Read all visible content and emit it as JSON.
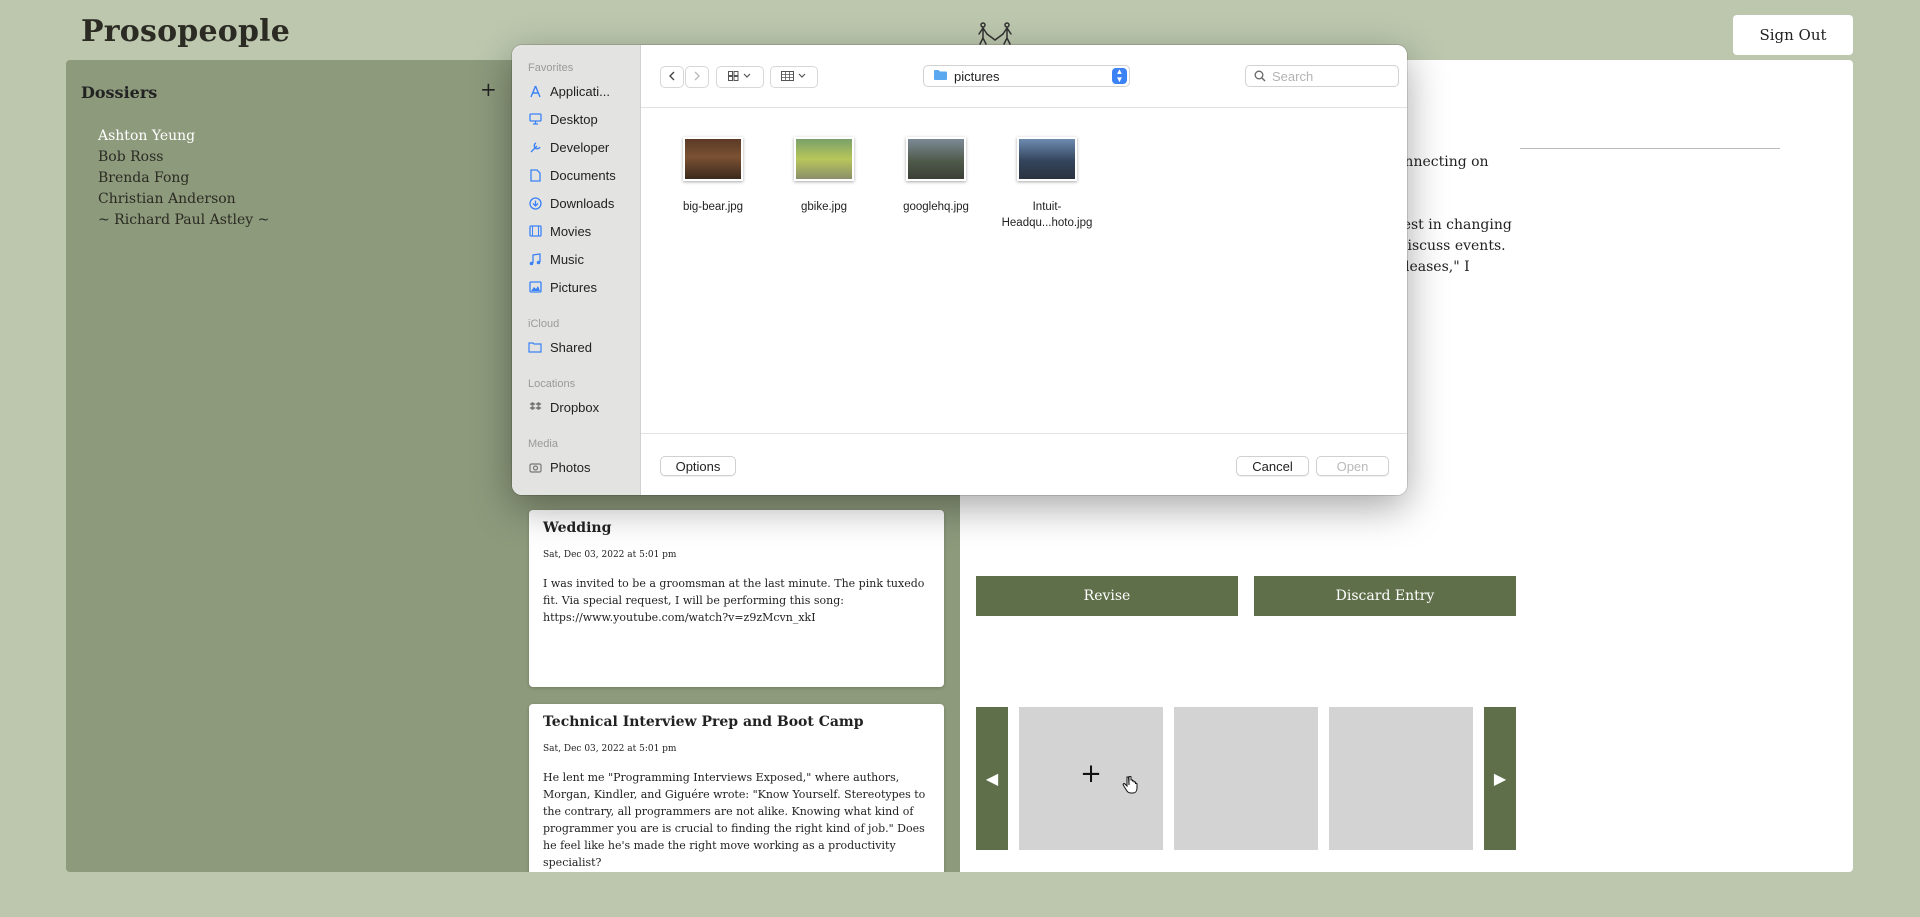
{
  "header": {
    "app_title": "Prosopeople",
    "sign_out_label": "Sign Out"
  },
  "sidebar": {
    "title": "Dossiers",
    "add_label": "+",
    "dossiers": [
      "Ashton Yeung",
      "Bob Ross",
      "Brenda Fong",
      "Christian Anderson",
      "~ Richard Paul Astley ~"
    ],
    "active_index": 0
  },
  "entries": [
    {
      "title": "Wedding",
      "date": "Sat, Dec 03, 2022 at 5:01 pm",
      "body": "I was invited to be a groomsman at the last minute. The pink tuxedo fit. Via special request, I will be performing this song: https://www.youtube.com/watch?v=z9zMcvn_xkI"
    },
    {
      "title": "Technical Interview Prep and Boot Camp",
      "date": "Sat, Dec 03, 2022 at 5:01 pm",
      "body": "He lent me \"Programming Interviews Exposed,\" where authors, Morgan, Kindler, and Giguére wrote: \"Know Yourself. Stereotypes to the contrary, all programmers are not alike. Knowing what kind of programmer you are is crucial to finding the right kind of job.\" Does he feel like he's made the right move working as a productivity specialist?"
    }
  ],
  "detail": {
    "text_fragments": [
      "onnecting on",
      "rest in changing",
      "liscuss events.",
      "leases,\" I"
    ],
    "revise_label": "Revise",
    "discard_label": "Discard Entry",
    "prev_arrow": "◀",
    "next_arrow": "▶",
    "add_photo_label": "+"
  },
  "file_dialog": {
    "sidebar": {
      "favorites_label": "Favorites",
      "favorites": [
        {
          "label": "Applicati...",
          "icon": "applications-icon"
        },
        {
          "label": "Desktop",
          "icon": "desktop-icon"
        },
        {
          "label": "Developer",
          "icon": "developer-icon"
        },
        {
          "label": "Documents",
          "icon": "documents-icon"
        },
        {
          "label": "Downloads",
          "icon": "downloads-icon"
        },
        {
          "label": "Movies",
          "icon": "movies-icon"
        },
        {
          "label": "Music",
          "icon": "music-icon"
        },
        {
          "label": "Pictures",
          "icon": "pictures-icon"
        }
      ],
      "icloud_label": "iCloud",
      "icloud": [
        {
          "label": "Shared",
          "icon": "shared-folder-icon"
        }
      ],
      "locations_label": "Locations",
      "locations": [
        {
          "label": "Dropbox",
          "icon": "dropbox-icon"
        }
      ],
      "media_label": "Media",
      "media": [
        {
          "label": "Photos",
          "icon": "photos-icon"
        }
      ]
    },
    "current_folder": "pictures",
    "search_placeholder": "Search",
    "files": [
      {
        "name": "big-bear.jpg",
        "name_line2": ""
      },
      {
        "name": "gbike.jpg",
        "name_line2": ""
      },
      {
        "name": "googlehq.jpg",
        "name_line2": ""
      },
      {
        "name": "Intuit-",
        "name_line2": "Headqu...hoto.jpg"
      }
    ],
    "options_label": "Options",
    "cancel_label": "Cancel",
    "open_label": "Open"
  },
  "colors": {
    "page_bg": "#bcc7ae",
    "panel_bg": "#8d9a7c",
    "accent": "#5f6f4a",
    "dialog_sidebar_bg": "#e3e3e1",
    "select_blue": "#3b82f6"
  }
}
